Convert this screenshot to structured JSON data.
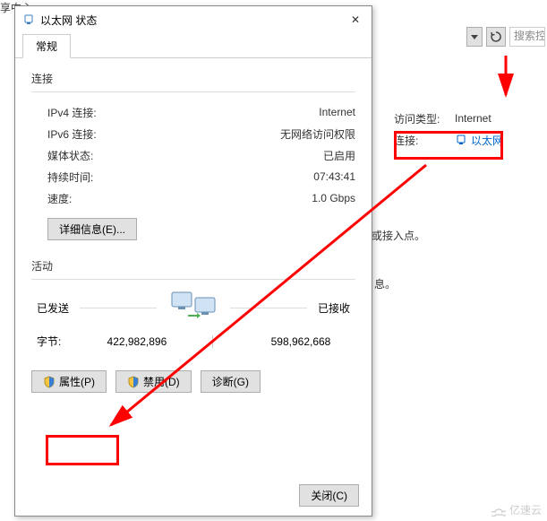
{
  "bg": {
    "top_title": "享中心",
    "search_placeholder": "搜索控",
    "right": {
      "access_label": "访问类型:",
      "access_value": "Internet",
      "conn_label": "连接:",
      "conn_link": "以太网",
      "text1": "或接入点。",
      "text2": "息。"
    }
  },
  "dialog": {
    "title": "以太网 状态",
    "tab": "常规",
    "conn_header": "连接",
    "fields": {
      "ipv4_k": "IPv4 连接:",
      "ipv4_v": "Internet",
      "ipv6_k": "IPv6 连接:",
      "ipv6_v": "无网络访问权限",
      "media_k": "媒体状态:",
      "media_v": "已启用",
      "dur_k": "持续时间:",
      "dur_v": "07:43:41",
      "speed_k": "速度:",
      "speed_v": "1.0 Gbps"
    },
    "details_btn": "详细信息(E)...",
    "activity_header": "活动",
    "sent_label": "已发送",
    "recv_label": "已接收",
    "bytes_label": "字节:",
    "sent_val": "422,982,896",
    "recv_val": "598,962,668",
    "prop_btn": "属性(P)",
    "disable_btn": "禁用(D)",
    "diag_btn": "诊断(G)",
    "close_btn": "关闭(C)"
  },
  "watermark": "亿速云"
}
